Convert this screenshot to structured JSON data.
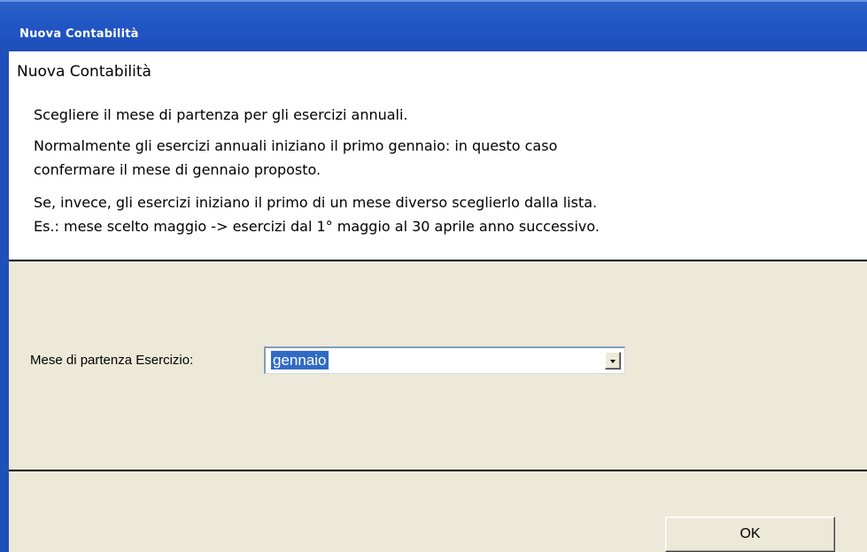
{
  "window": {
    "title": "Nuova Contabilità"
  },
  "header": {
    "title": "Nuova Contabilità",
    "lines": [
      "Scegliere il mese di partenza per gli esercizi annuali.",
      "Normalmente gli esercizi annuali iniziano il primo gennaio: in questo caso",
      "confermare il mese di gennaio proposto.",
      "Se, invece, gli esercizi iniziano il primo di un mese diverso sceglierlo dalla lista.",
      "Es.: mese scelto maggio -> esercizi dal 1° maggio al 30 aprile anno successivo."
    ]
  },
  "form": {
    "month_label": "Mese di partenza Esercizio:",
    "month_value": "gennaio"
  },
  "buttons": {
    "ok_label": "OK"
  },
  "colors": {
    "titlebar": "#2056c4",
    "selection": "#316ac5",
    "dialog_background": "#ece9d8"
  }
}
